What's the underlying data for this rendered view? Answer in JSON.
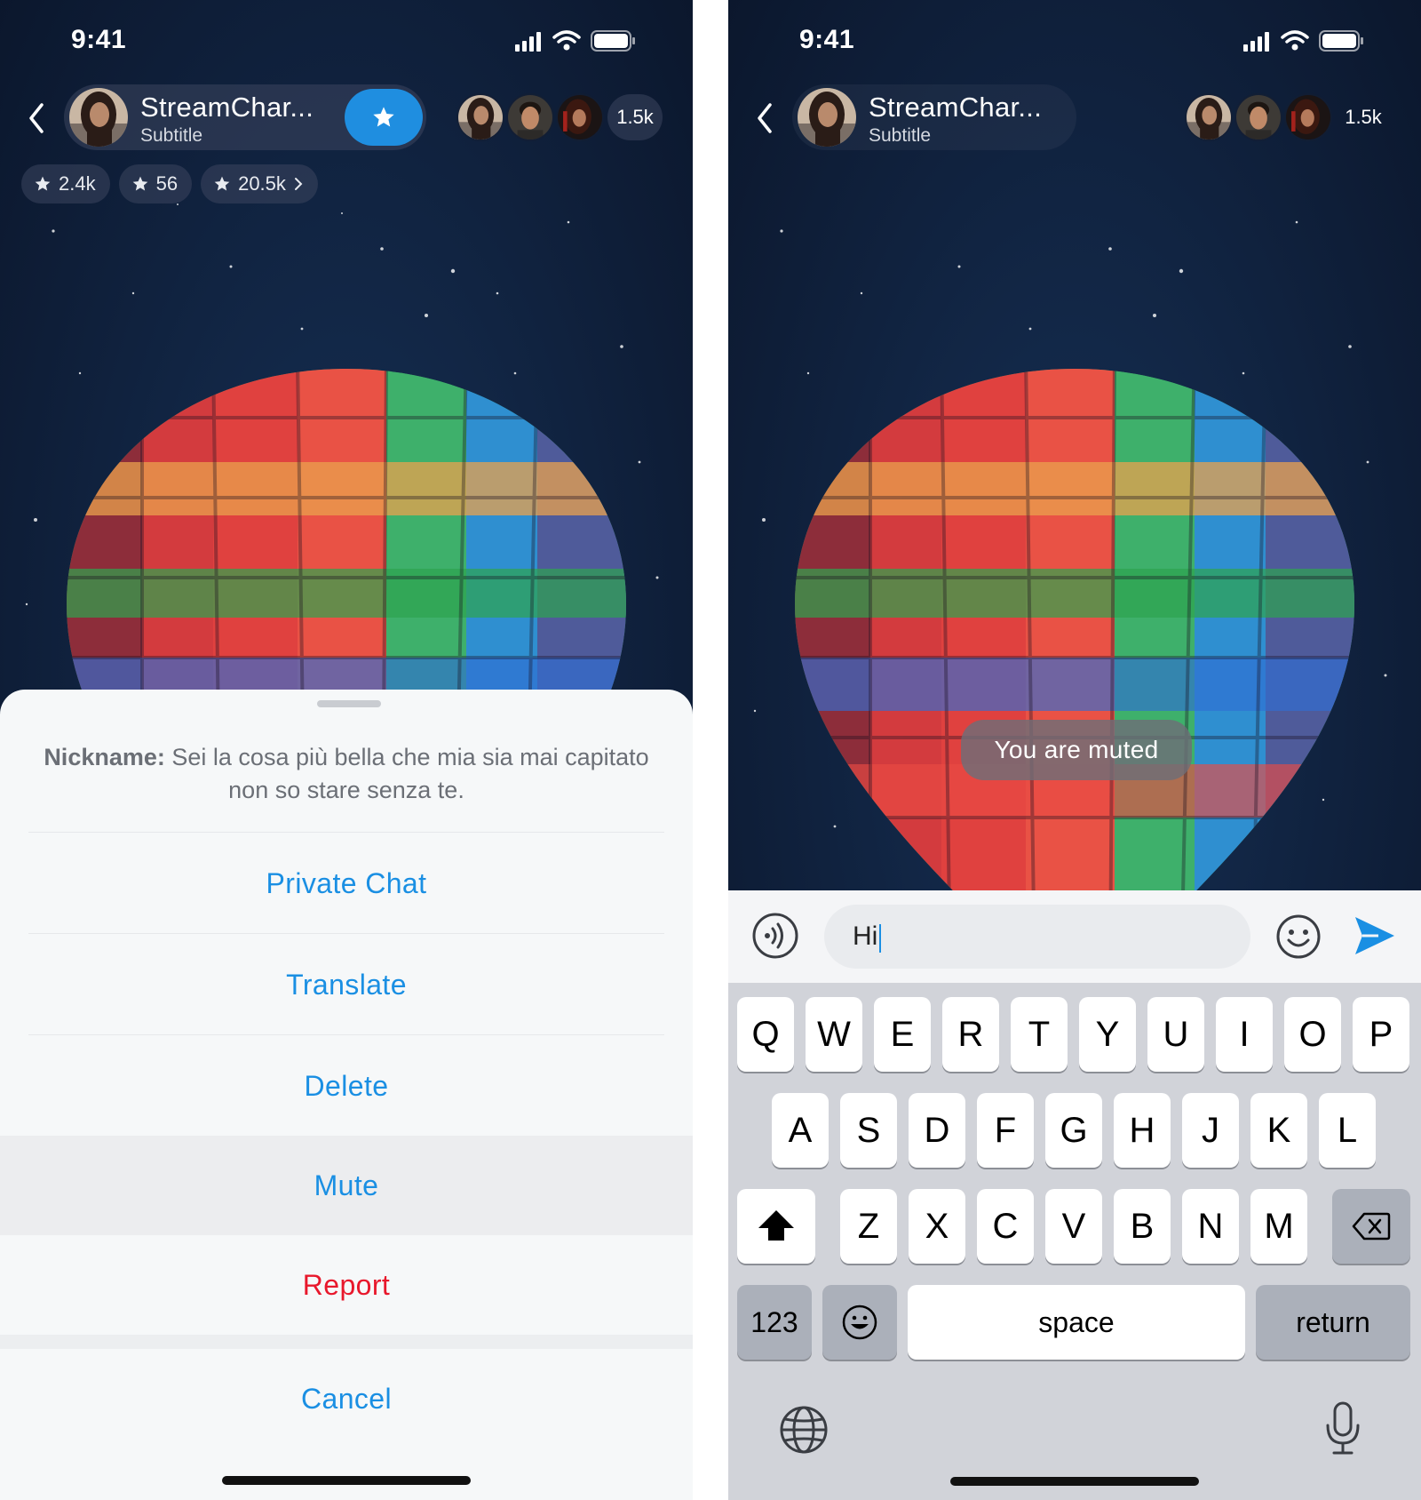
{
  "colors": {
    "accent": "#1a8fe3",
    "danger": "#e8182c",
    "sheet_background": "#f6f8f9",
    "night_sky": "#0f1d35"
  },
  "left_screen": {
    "status": {
      "time": "9:41"
    },
    "header": {
      "channel_name": "StreamChar...",
      "channel_subtitle": "Subtitle",
      "viewer_count": "1.5k",
      "icons": [
        "back-chevron-icon",
        "star-icon"
      ]
    },
    "stats": [
      {
        "icon": "star-icon",
        "value": "2.4k"
      },
      {
        "icon": "star-icon",
        "value": "56"
      },
      {
        "icon": "star-icon",
        "value": "20.5k",
        "has_chevron": true
      }
    ],
    "sheet": {
      "nickname_label": "Nickname:",
      "nickname_text": "Sei la cosa più bella che mia sia mai capitato non so stare senza te.",
      "actions": [
        {
          "label": "Private Chat",
          "style": "default"
        },
        {
          "label": "Translate",
          "style": "default"
        },
        {
          "label": "Delete",
          "style": "default"
        },
        {
          "label": "Mute",
          "style": "selected"
        },
        {
          "label": "Report",
          "style": "danger"
        }
      ],
      "cancel_label": "Cancel"
    }
  },
  "right_screen": {
    "status": {
      "time": "9:41"
    },
    "header": {
      "channel_name": "StreamChar...",
      "channel_subtitle": "Subtitle",
      "viewer_count": "1.5k"
    },
    "toast": "You are muted",
    "composer": {
      "value": "Hi",
      "icons": [
        "voice-icon",
        "emoji-icon",
        "send-icon"
      ]
    },
    "keyboard": {
      "row1": [
        "Q",
        "W",
        "E",
        "R",
        "T",
        "Y",
        "U",
        "I",
        "O",
        "P"
      ],
      "row2": [
        "A",
        "S",
        "D",
        "F",
        "G",
        "H",
        "J",
        "K",
        "L"
      ],
      "row3": [
        "Z",
        "X",
        "C",
        "V",
        "B",
        "N",
        "M"
      ],
      "numbers_label": "123",
      "space_label": "space",
      "return_label": "return",
      "icons": [
        "shift-icon",
        "backspace-icon",
        "emoji-key-icon",
        "globe-icon",
        "microphone-icon"
      ]
    }
  }
}
